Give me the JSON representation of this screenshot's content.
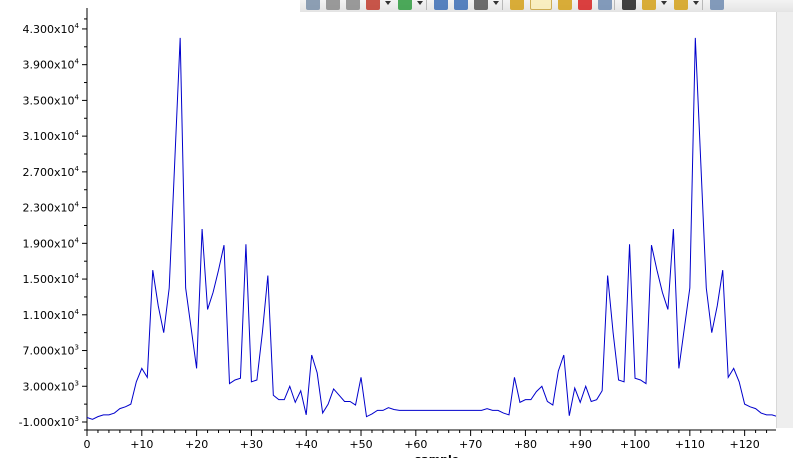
{
  "toolbar": {
    "icons": [
      "layout-icon",
      "add-icon",
      "align-icon",
      "chart-edit-icon",
      "dropdown-icon",
      "add-green-icon",
      "dropdown-icon",
      "zoom-in-icon",
      "zoom-out-icon",
      "zoom-box-icon",
      "dropdown-icon",
      "history-back-icon",
      "history-active-icon",
      "history-forward-icon",
      "delete-icon",
      "window-icon",
      "grid-icon",
      "cursor-icon",
      "dropdown-icon",
      "lock-icon",
      "dropdown-icon",
      "panel-icon"
    ]
  },
  "chart_data": {
    "type": "line",
    "xlabel": "sample",
    "ylabel": "",
    "xlim": [
      0,
      127
    ],
    "ylim": [
      -1000,
      44000
    ],
    "grid": false,
    "series_color": "#0000cc",
    "x_ticks": [
      0,
      10,
      20,
      30,
      40,
      50,
      60,
      70,
      80,
      90,
      100,
      110,
      120
    ],
    "x_tick_labels": [
      "0",
      "+10",
      "+20",
      "+30",
      "+40",
      "+50",
      "+60",
      "+70",
      "+80",
      "+90",
      "+100",
      "+110",
      "+120"
    ],
    "y_ticks": [
      {
        "mantissa": "-1.000x10",
        "exp": "3",
        "value": -1000
      },
      {
        "mantissa": "3.000x10",
        "exp": "3",
        "value": 3000
      },
      {
        "mantissa": "7.000x10",
        "exp": "3",
        "value": 7000
      },
      {
        "mantissa": "1.100x10",
        "exp": "4",
        "value": 11000
      },
      {
        "mantissa": "1.500x10",
        "exp": "4",
        "value": 15000
      },
      {
        "mantissa": "1.900x10",
        "exp": "4",
        "value": 19000
      },
      {
        "mantissa": "2.300x10",
        "exp": "4",
        "value": 23000
      },
      {
        "mantissa": "2.700x10",
        "exp": "4",
        "value": 27000
      },
      {
        "mantissa": "3.100x10",
        "exp": "4",
        "value": 31000
      },
      {
        "mantissa": "3.500x10",
        "exp": "4",
        "value": 35000
      },
      {
        "mantissa": "3.900x10",
        "exp": "4",
        "value": 39000
      },
      {
        "mantissa": "4.300x10",
        "exp": "4",
        "value": 43000
      }
    ],
    "series": [
      {
        "values": [
          -500,
          -700,
          -400,
          -200,
          -200,
          0,
          500,
          700,
          1000,
          3500,
          5000,
          4000,
          16000,
          12000,
          9000,
          14000,
          28000,
          42000,
          14000,
          9500,
          5000,
          20600,
          11600,
          13500,
          16000,
          18800,
          3300,
          3700,
          3900,
          18900,
          3500,
          3700,
          9000,
          15400,
          2000,
          1500,
          1500,
          3000,
          1200,
          2500,
          -200,
          6500,
          4500,
          0,
          1000,
          2700,
          2000,
          1300,
          1300,
          900,
          4000,
          -400,
          -100,
          300,
          300,
          600,
          400,
          300,
          300,
          300,
          300,
          300,
          300,
          300,
          300,
          300,
          300,
          300,
          300,
          300,
          300,
          300,
          300,
          500,
          300,
          300,
          0,
          -200,
          4000,
          1200,
          1500,
          1500,
          2400,
          3000,
          1300,
          900,
          4700,
          6500,
          -300,
          2800,
          1200,
          3000,
          1300,
          1500,
          2500,
          15400,
          9000,
          3700,
          3500,
          18900,
          3900,
          3700,
          3300,
          18800,
          16000,
          13500,
          11600,
          20600,
          5000,
          9500,
          14000,
          42000,
          28000,
          14000,
          9000,
          12000,
          16000,
          4000,
          5000,
          3500,
          1000,
          700,
          500,
          0,
          -200,
          -200,
          -400,
          -700
        ]
      }
    ]
  }
}
